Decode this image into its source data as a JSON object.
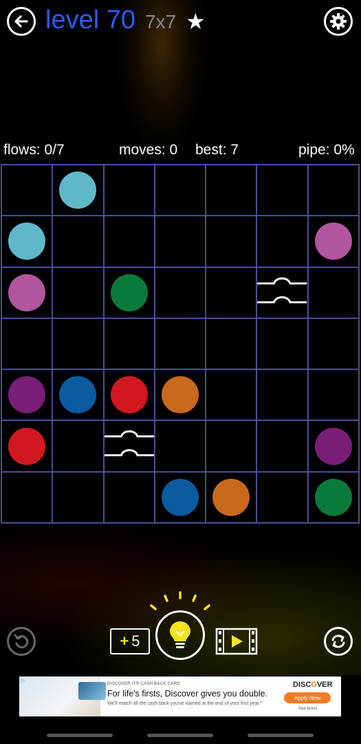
{
  "header": {
    "title": "level 70",
    "size": "7x7",
    "star": "★"
  },
  "stats": {
    "flows": "flows: 0/7",
    "moves": "moves: 0",
    "best": "best: 7",
    "pipe": "pipe: 0%"
  },
  "colors": {
    "cyan": "#5fb8c9",
    "pink": "#b1569f",
    "green": "#0a7a3c",
    "purple": "#7a1e78",
    "blue": "#0b5ba0",
    "red": "#d1181f",
    "orange": "#c8691d",
    "grid": "#4a4f9a",
    "title": "#2e5bff",
    "accent": "#f5e51e"
  },
  "board": {
    "rows": 7,
    "cols": 7,
    "cells": [
      [
        "",
        "cyan",
        "",
        "",
        "",
        "",
        ""
      ],
      [
        "cyan",
        "",
        "",
        "",
        "",
        "",
        "pink"
      ],
      [
        "pink",
        "",
        "green",
        "",
        "",
        "bridge",
        ""
      ],
      [
        "",
        "",
        "",
        "",
        "",
        "",
        ""
      ],
      [
        "purple",
        "blue",
        "red",
        "orange",
        "",
        "",
        ""
      ],
      [
        "red",
        "",
        "bridge",
        "",
        "",
        "",
        "purple"
      ],
      [
        "",
        "",
        "",
        "blue",
        "orange",
        "",
        "green"
      ]
    ]
  },
  "controls": {
    "hint_count": "5",
    "hint_plus": "+"
  },
  "ad": {
    "small_header": "DISCOVER IT® CASH BACK CARD",
    "headline": "For life's firsts, Discover gives you double.",
    "subline": "We'll match all the cash back you've earned at the end of your first year.*",
    "brand_prefix": "DISC",
    "brand_o": "O",
    "brand_suffix": "VER",
    "cta": "Apply Now",
    "terms": "See terms",
    "info": "▷"
  }
}
